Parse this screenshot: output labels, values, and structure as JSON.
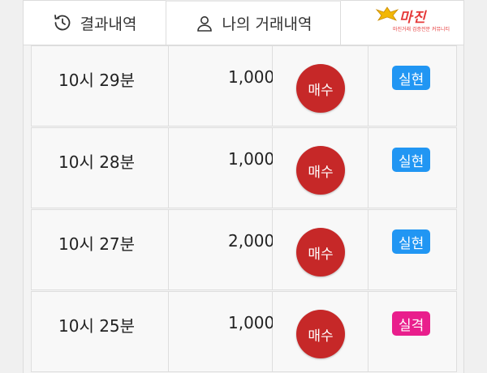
{
  "tabs": {
    "results": {
      "label": "결과내역",
      "icon": "history-icon"
    },
    "my_trades": {
      "label": "나의 거래내역",
      "icon": "user-icon"
    }
  },
  "watermark": {
    "brand": "마진",
    "tagline": "마진거래 검증전문 커뮤니티"
  },
  "colors": {
    "buy": "#c62828",
    "realized": "#2196f3",
    "failed": "#e91e8c"
  },
  "rows": [
    {
      "time": "10시 29분",
      "amount": "1,000",
      "type": "매수",
      "result": "실현",
      "result_color": "#2196f3"
    },
    {
      "time": "10시 28분",
      "amount": "1,000",
      "type": "매수",
      "result": "실현",
      "result_color": "#2196f3"
    },
    {
      "time": "10시 27분",
      "amount": "2,000",
      "type": "매수",
      "result": "실현",
      "result_color": "#2196f3"
    },
    {
      "time": "10시 25분",
      "amount": "1,000",
      "type": "매수",
      "result": "실격",
      "result_color": "#e91e8c"
    }
  ]
}
